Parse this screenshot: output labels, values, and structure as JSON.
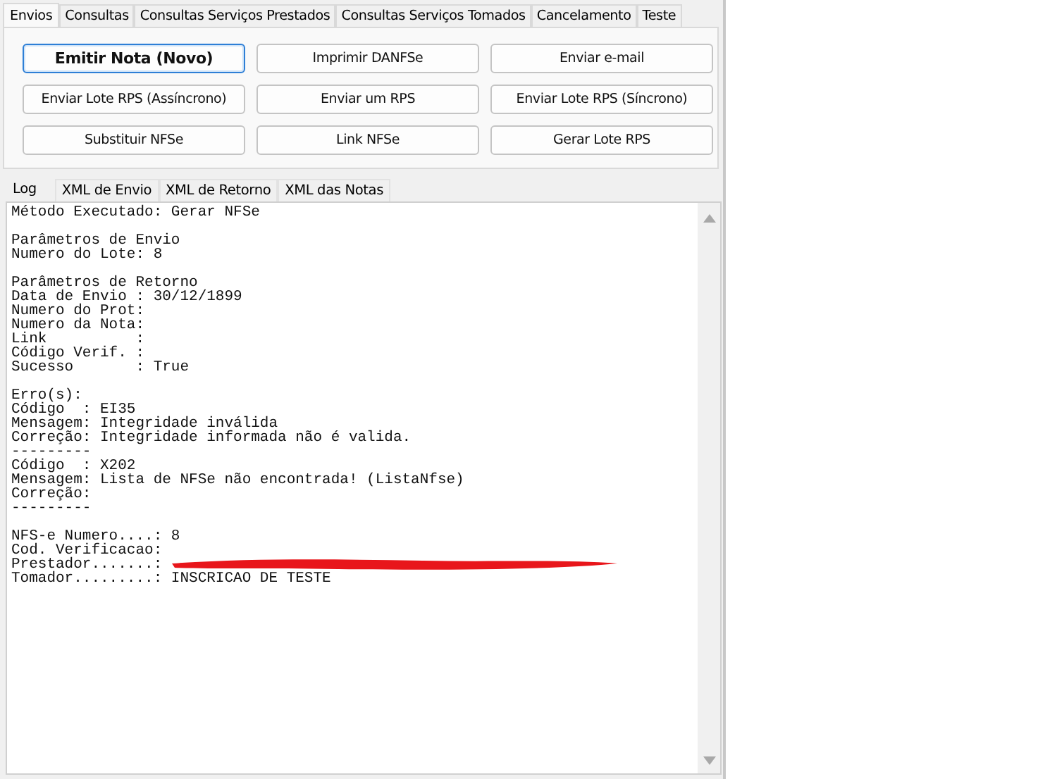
{
  "top_tabs": [
    {
      "label": "Envios",
      "selected": true
    },
    {
      "label": "Consultas",
      "selected": false
    },
    {
      "label": "Consultas Serviços Prestados",
      "selected": false
    },
    {
      "label": "Consultas Serviços Tomados",
      "selected": false
    },
    {
      "label": "Cancelamento",
      "selected": false
    },
    {
      "label": "Teste",
      "selected": false
    }
  ],
  "buttons": [
    {
      "label": "Emitir Nota (Novo)",
      "focused": true
    },
    {
      "label": "Imprimir DANFSe",
      "focused": false
    },
    {
      "label": "Enviar e-mail",
      "focused": false
    },
    {
      "label": "Enviar Lote RPS (Assíncrono)",
      "focused": false
    },
    {
      "label": "Enviar um RPS",
      "focused": false
    },
    {
      "label": "Enviar Lote RPS (Síncrono)",
      "focused": false
    },
    {
      "label": "Substituir NFSe",
      "focused": false
    },
    {
      "label": "Link NFSe",
      "focused": false
    },
    {
      "label": "Gerar Lote RPS",
      "focused": false
    }
  ],
  "log_tabs": [
    {
      "label": "Log",
      "selected": true
    },
    {
      "label": "XML de Envio",
      "selected": false
    },
    {
      "label": "XML de Retorno",
      "selected": false
    },
    {
      "label": "XML das Notas",
      "selected": false
    }
  ],
  "log": [
    {
      "lines": [
        {
          "text": "Método Executado: Gerar NFSe",
          "redacted": false
        }
      ]
    },
    {
      "lines": [
        {
          "text": "Parâmetros de Envio",
          "redacted": false
        },
        {
          "text": "Numero do Lote: 8",
          "redacted": false
        }
      ]
    },
    {
      "lines": [
        {
          "text": "Parâmetros de Retorno",
          "redacted": false
        },
        {
          "text": "Data de Envio : 30/12/1899",
          "redacted": false
        },
        {
          "text": "Numero do Prot:",
          "redacted": false
        },
        {
          "text": "Numero da Nota:",
          "redacted": false
        },
        {
          "text": "Link          :",
          "redacted": false
        },
        {
          "text": "Código Verif. :",
          "redacted": false
        },
        {
          "text": "Sucesso       : True",
          "redacted": false
        }
      ]
    },
    {
      "lines": [
        {
          "text": "Erro(s):",
          "redacted": false
        },
        {
          "text": "Código  : EI35",
          "redacted": false
        },
        {
          "text": "Mensagem: Integridade inválida",
          "redacted": false
        },
        {
          "text": "Correção: Integridade informada não é valida.",
          "redacted": false
        },
        {
          "text": "---------",
          "redacted": false
        },
        {
          "text": "Código  : X202",
          "redacted": false
        },
        {
          "text": "Mensagem: Lista de NFSe não encontrada! (ListaNfse)",
          "redacted": false
        },
        {
          "text": "Correção:",
          "redacted": false
        },
        {
          "text": "---------",
          "redacted": false
        }
      ]
    },
    {
      "lines": [
        {
          "text": "NFS-e Numero....: 8",
          "redacted": false
        },
        {
          "text": "Cod. Verificacao:",
          "redacted": false
        },
        {
          "text": "Prestador.......:",
          "redacted": true
        },
        {
          "text": "Tomador.........: INSCRICAO DE TESTE",
          "redacted": false
        }
      ]
    }
  ]
}
